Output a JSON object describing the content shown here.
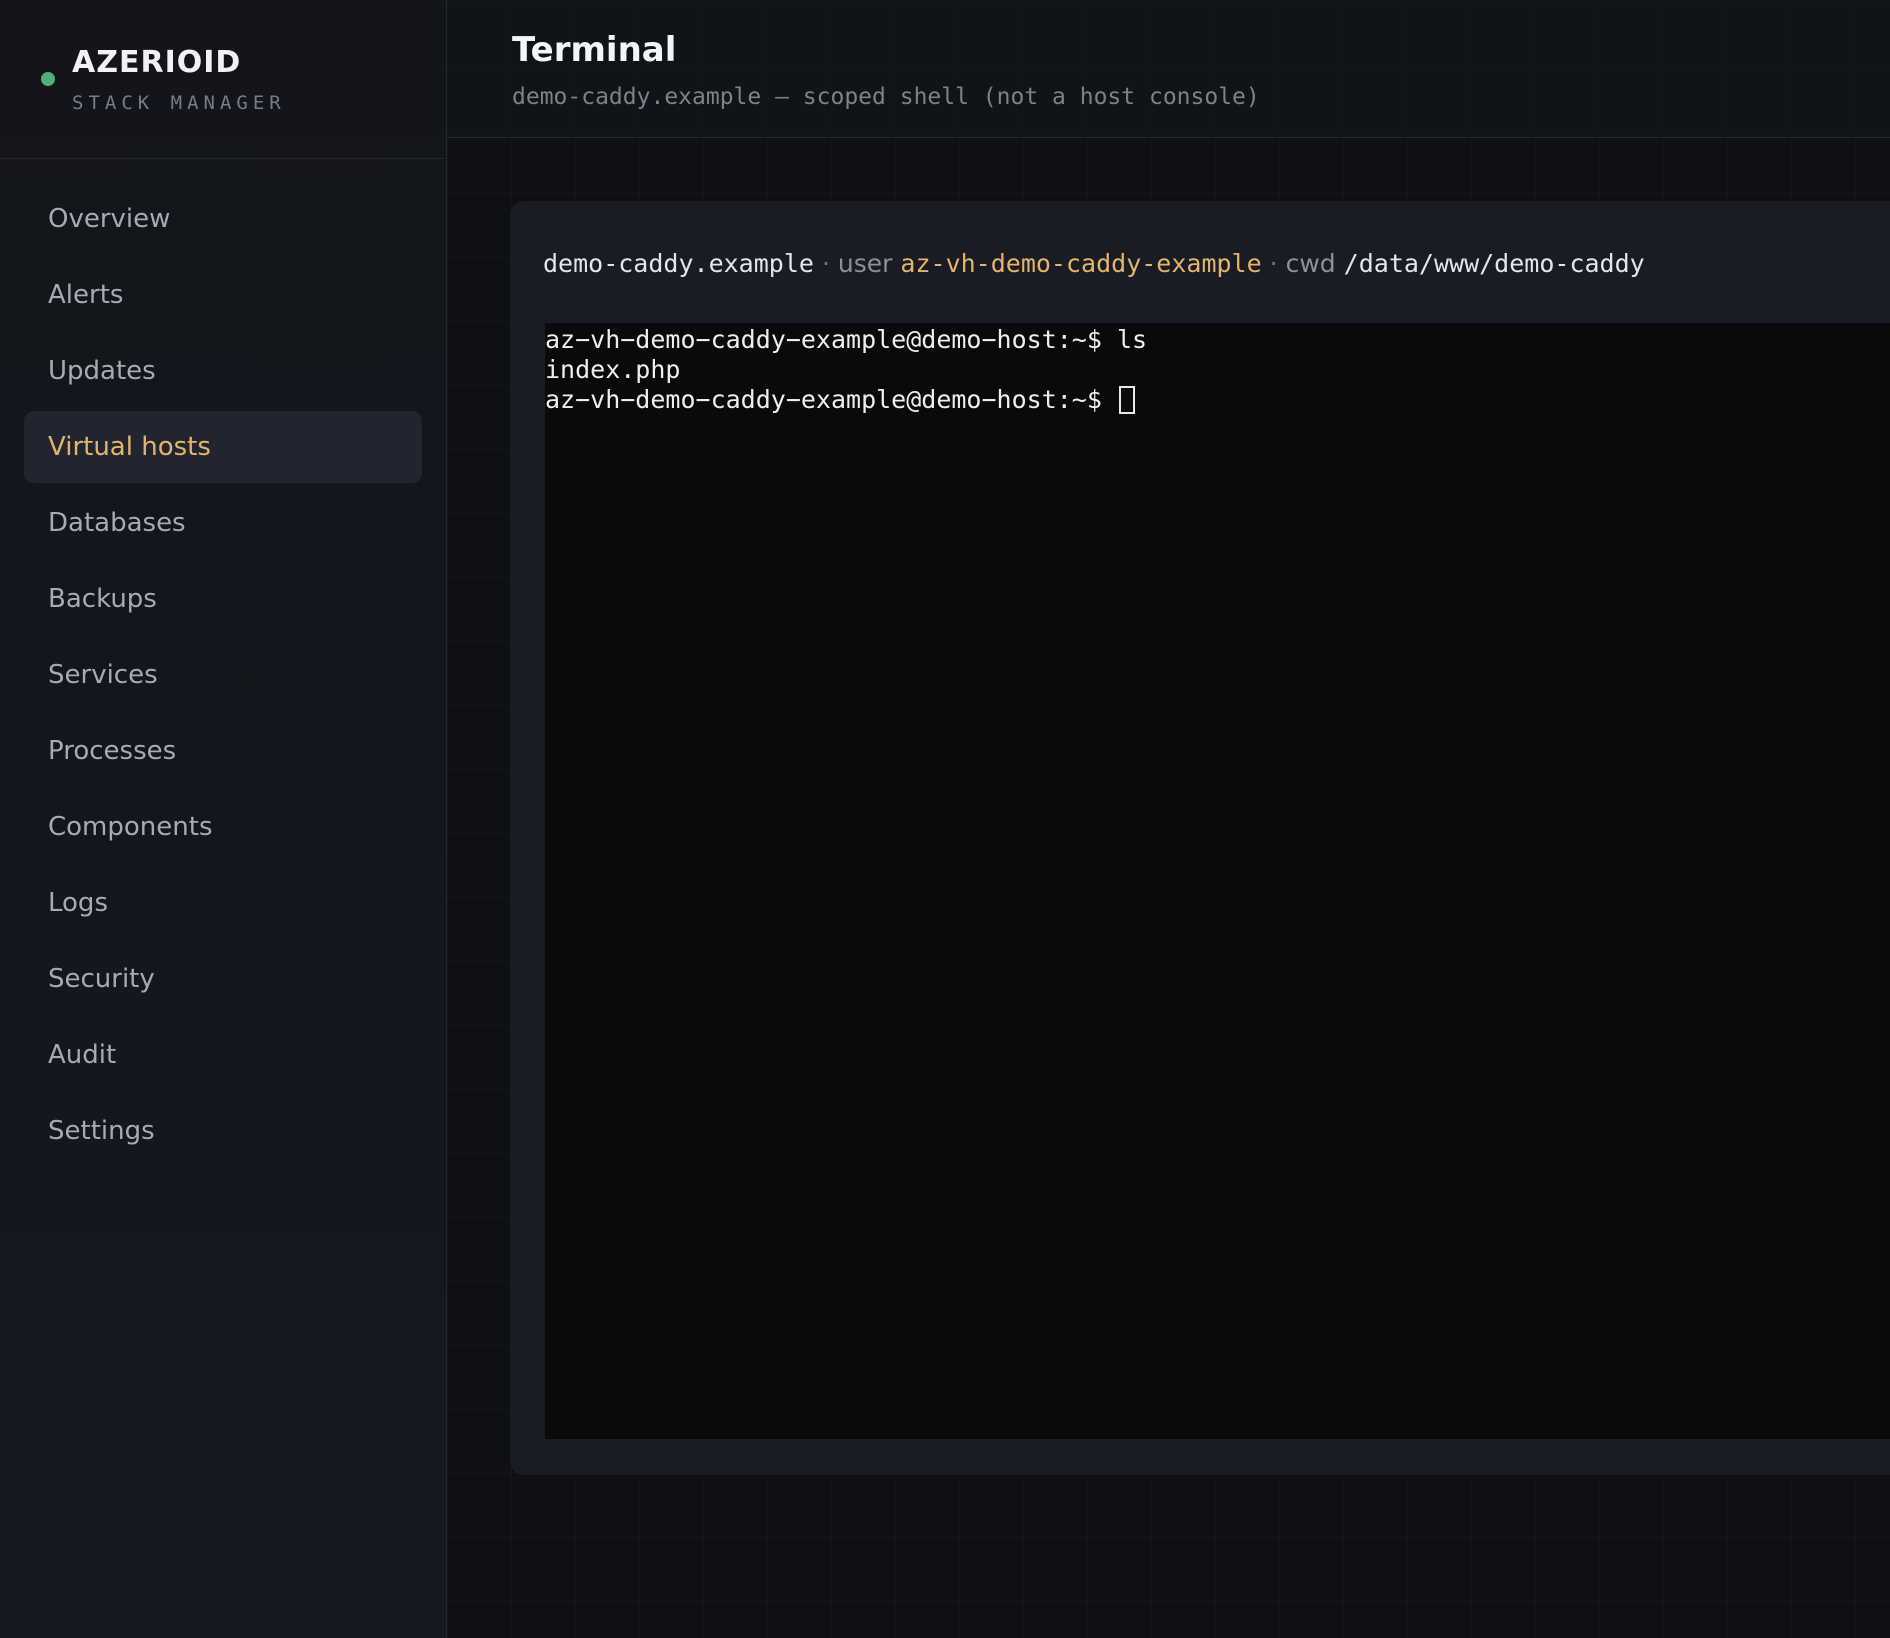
{
  "brand": {
    "name": "AZERIOID",
    "subtitle": "STACK MANAGER",
    "status_color": "#4fae79"
  },
  "sidebar": {
    "items": [
      {
        "label": "Overview",
        "active": false
      },
      {
        "label": "Alerts",
        "active": false
      },
      {
        "label": "Updates",
        "active": false
      },
      {
        "label": "Virtual hosts",
        "active": true
      },
      {
        "label": "Databases",
        "active": false
      },
      {
        "label": "Backups",
        "active": false
      },
      {
        "label": "Services",
        "active": false
      },
      {
        "label": "Processes",
        "active": false
      },
      {
        "label": "Components",
        "active": false
      },
      {
        "label": "Logs",
        "active": false
      },
      {
        "label": "Security",
        "active": false
      },
      {
        "label": "Audit",
        "active": false
      },
      {
        "label": "Settings",
        "active": false
      }
    ]
  },
  "header": {
    "title": "Terminal",
    "subtitle": "demo-caddy.example — scoped shell (not a host console)"
  },
  "session": {
    "host": "demo-caddy.example",
    "separator": "·",
    "user_label": "user",
    "user": "az-vh-demo-caddy-example",
    "cwd_label": "cwd",
    "cwd": "/data/www/demo-caddy"
  },
  "terminal": {
    "lines": [
      "az−vh−demo−caddy−example@demo−host:~$ ls",
      "index.php"
    ],
    "prompt": "az−vh−demo−caddy−example@demo−host:~$ "
  },
  "colors": {
    "accent": "#e3b469",
    "background": "#0e1014",
    "sidebar": "#13151a",
    "card": "#191c24",
    "terminal": "#0a0a0b"
  }
}
